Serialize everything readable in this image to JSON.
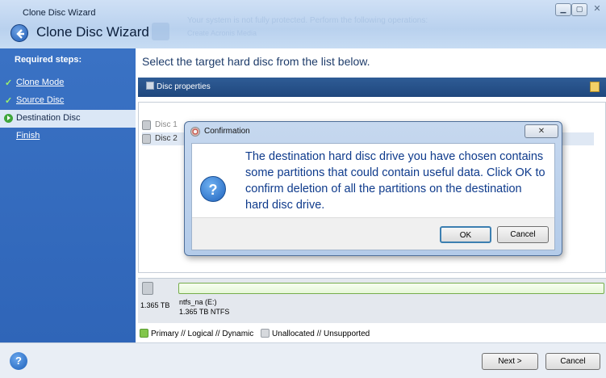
{
  "window": {
    "title": "Clone Disc Wizard",
    "heading": "Clone Disc Wizard",
    "ghost_banner": "Your system is not fully protected. Perform the following operations:",
    "ghost_banner_2": "Create Acronis Media"
  },
  "sidebar": {
    "required_title": "Required steps:",
    "steps": [
      {
        "label": "Clone Mode",
        "status": "done"
      },
      {
        "label": "Source Disc",
        "status": "done"
      },
      {
        "label": "Destination Disc",
        "status": "active"
      },
      {
        "label": "Finish",
        "status": "pending"
      }
    ]
  },
  "main": {
    "title": "Select the target hard disc from the list below.",
    "toolbar_label": "Disc properties",
    "discs": [
      {
        "label": "Disc 1",
        "enabled": false
      },
      {
        "label": "Disc 2",
        "selected": true
      }
    ],
    "partition": {
      "disk_size": "1.365 TB",
      "name": "ntfs_na (E:)",
      "size_fs": "1.365 TB  NTFS"
    },
    "legend": {
      "primary": "Primary // Logical // Dynamic",
      "unallocated": "Unallocated // Unsupported"
    }
  },
  "dialog": {
    "title": "Confirmation",
    "message": "The destination hard disc drive you have chosen contains some partitions that could contain useful data. Click OK to confirm deletion of all the partitions on the destination hard disc drive.",
    "ok_label": "OK",
    "cancel_label": "Cancel"
  },
  "buttons": {
    "next": "Next >",
    "cancel": "Cancel"
  },
  "icons": {
    "back": "back-arrow-icon",
    "help": "help-icon",
    "question": "question-icon",
    "check": "checkmark-icon"
  },
  "colors": {
    "sidebar": "#2f65b8",
    "toolbar": "#1f477d",
    "dialog_text": "#0f3b8c",
    "primary_partition": "#82c64c"
  }
}
